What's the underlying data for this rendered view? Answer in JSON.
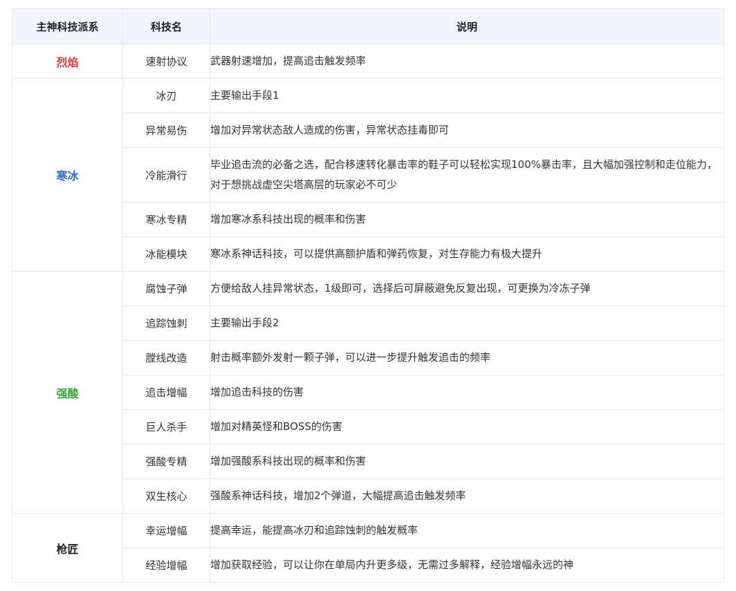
{
  "headers": [
    "主神科技派系",
    "科技名",
    "说明"
  ],
  "schools": [
    {
      "name": "烈焰",
      "color": "#e4393c",
      "rows": [
        {
          "tech": "速射协议",
          "desc": "武器射速增加，提高追击触发频率"
        }
      ]
    },
    {
      "name": "寒冰",
      "color": "#2b6fd6",
      "rows": [
        {
          "tech": "冰刃",
          "desc": "主要输出手段1"
        },
        {
          "tech": "异常易伤",
          "desc": "增加对异常状态敌人造成的伤害，异常状态挂毒即可"
        },
        {
          "tech": "冷能滑行",
          "desc": "毕业追击流的必备之选，配合移速转化暴击率的鞋子可以轻松实现100%暴击率，且大幅加强控制和走位能力，对于想挑战虚空尖塔高层的玩家必不可少"
        },
        {
          "tech": "寒冰专精",
          "desc": "增加寒冰系科技出现的概率和伤害"
        },
        {
          "tech": "冰能模块",
          "desc": "寒冰系神话科技，可以提供高额护盾和弹药恢复，对生存能力有极大提升"
        }
      ]
    },
    {
      "name": "强酸",
      "color": "#3aa53a",
      "rows": [
        {
          "tech": "腐蚀子弹",
          "desc": "方便给敌人挂异常状态，1级即可，选择后可屏蔽避免反复出现，可更换为冷冻子弹"
        },
        {
          "tech": "追踪蚀刺",
          "desc": "主要输出手段2"
        },
        {
          "tech": "膛线改造",
          "desc": "射击概率额外发射一颗子弹，可以进一步提升触发追击的频率"
        },
        {
          "tech": "追击增幅",
          "desc": "增加追击科技的伤害"
        },
        {
          "tech": "巨人杀手",
          "desc": "增加对精英怪和BOSS的伤害"
        },
        {
          "tech": "强酸专精",
          "desc": "增加强酸系科技出现的概率和伤害"
        },
        {
          "tech": "双生核心",
          "desc": "强酸系神话科技，增加2个弹道，大幅提高追击触发频率"
        }
      ]
    },
    {
      "name": "枪匠",
      "color": "#222222",
      "rows": [
        {
          "tech": "幸运增幅",
          "desc": "提高幸运，能提高冰刃和追踪蚀刺的触发概率"
        },
        {
          "tech": "经验增幅",
          "desc": "增加获取经验，可以让你在单局内升更多级，无需过多解释，经验增幅永远的神"
        }
      ]
    }
  ]
}
